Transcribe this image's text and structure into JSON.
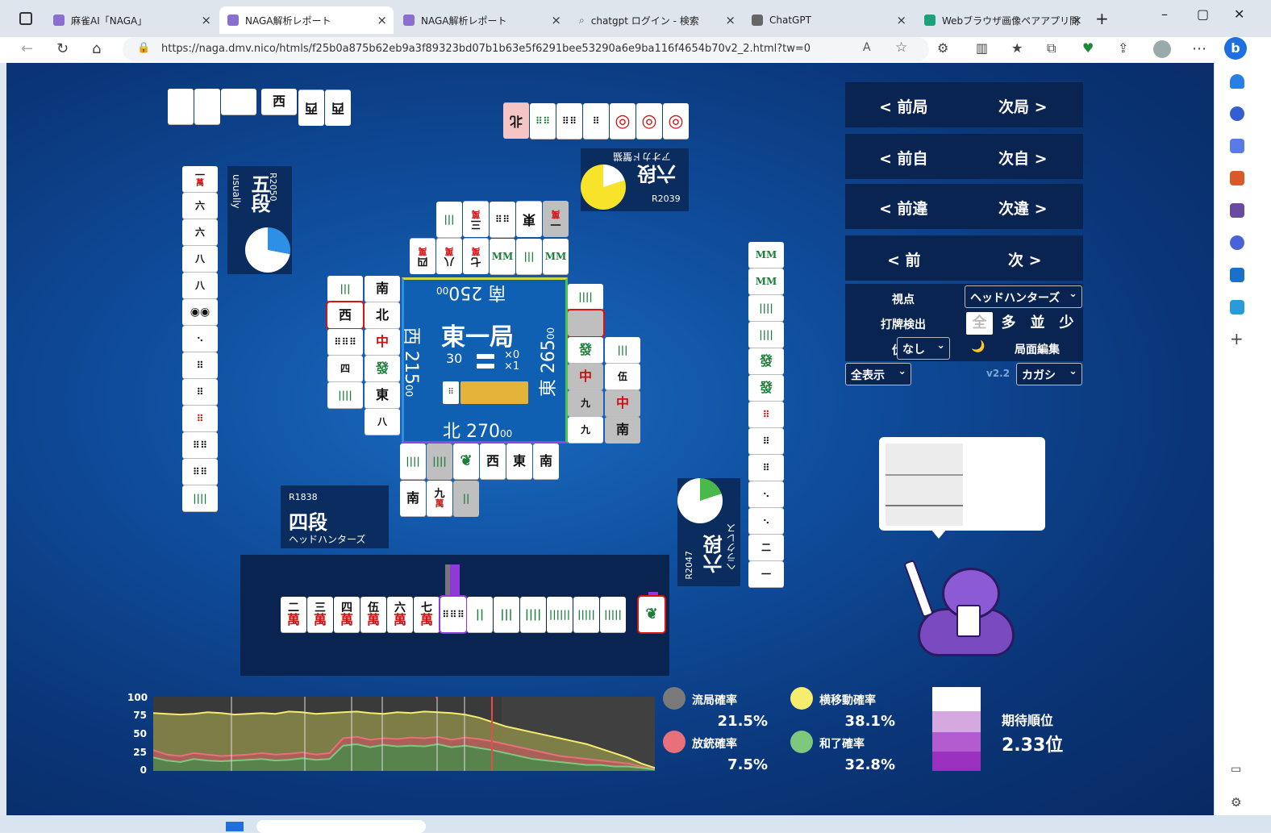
{
  "browser": {
    "tabs": [
      {
        "title": "麻雀AI「NAGA」",
        "active": false
      },
      {
        "title": "NAGA解析レポート",
        "active": true
      },
      {
        "title": "NAGA解析レポート",
        "active": false
      },
      {
        "title": "chatgpt ログイン - 検索",
        "active": false
      },
      {
        "title": "ChatGPT",
        "active": false
      },
      {
        "title": "Webブラウザ画像ペアアプリ開発",
        "active": false
      }
    ],
    "url": "https://naga.dmv.nico/htmls/f25b0a875b62eb9a3f89323bd07b1b63e5f6291bee53290a6e9ba116f4654b70v2_2.html?tw=0"
  },
  "board": {
    "round": "東一局",
    "honba_left": "30",
    "honba_x0": "×0",
    "honba_x1": "×1",
    "scores": {
      "south": "南 250",
      "south_sub": "00",
      "west": "西 215",
      "west_sub": "00",
      "east": "東 265",
      "east_sub": "00",
      "north": "北 270",
      "north_sub": "00"
    }
  },
  "players": {
    "top": {
      "rate": "R2039",
      "rank": "六段",
      "name": "アオカド蟹猫"
    },
    "left": {
      "rate": "R2050",
      "rank": "五段",
      "name": "usually"
    },
    "right": {
      "rate": "R2047",
      "rank": "六段",
      "name": "ヘラクレス"
    },
    "bottom": {
      "rate": "R1838",
      "rank": "四段",
      "name": "ヘッドハンターズ"
    }
  },
  "hand": [
    {
      "num": "二",
      "suit": "萬"
    },
    {
      "num": "三",
      "suit": "萬"
    },
    {
      "num": "四",
      "suit": "萬"
    },
    {
      "num": "伍",
      "suit": "萬"
    },
    {
      "num": "六",
      "suit": "萬"
    },
    {
      "num": "七",
      "suit": "萬"
    }
  ],
  "controls": {
    "prev_round": "< 前局",
    "next_round": "次局 >",
    "prev_self": "< 前自",
    "next_self": "次自 >",
    "prev_diff": "< 前違",
    "next_diff": "次違 >",
    "prev": "< 前",
    "next": "次 >",
    "viewpoint_label": "視点",
    "viewpoint_value": "ヘッドハンターズ",
    "detect_label": "打牌検出",
    "detect_options": [
      "全",
      "多",
      "並",
      "少"
    ],
    "hidden_label": "伏牌",
    "hidden_value": "なし",
    "moon_icon": "🌙",
    "edit_label": "局面編集",
    "display_value": "全表示",
    "version": "v2.2",
    "model_value": "カガシ"
  },
  "stats": {
    "draw_label": "流局確率",
    "draw_value": "21.5%",
    "move_label": "横移動確率",
    "move_value": "38.1%",
    "deal_in_label": "放銃確率",
    "deal_in_value": "7.5%",
    "win_label": "和了確率",
    "win_value": "32.8%",
    "rank_label": "期待順位",
    "rank_value": "2.33位",
    "colors": {
      "draw": "#7a7a7a",
      "move": "#f6ec6e",
      "deal_in": "#e8707a",
      "win": "#7ec87e"
    }
  },
  "chart_data": {
    "type": "area",
    "yticks": [
      "100",
      "75",
      "50",
      "25",
      "0"
    ],
    "ylim": [
      0,
      100
    ],
    "series": [
      {
        "values": [
          78,
          77,
          76,
          77,
          79,
          78,
          76,
          77,
          78,
          77,
          80,
          79,
          77,
          78,
          79,
          80,
          78,
          77,
          79,
          78,
          80,
          79,
          78,
          76,
          72,
          66,
          60,
          56,
          52,
          48,
          44,
          40,
          36,
          30,
          24,
          18,
          10,
          4
        ]
      },
      {
        "values": [
          28,
          22,
          20,
          24,
          22,
          20,
          21,
          22,
          24,
          22,
          23,
          25,
          22,
          24,
          44,
          46,
          42,
          44,
          43,
          45,
          44,
          46,
          42,
          45,
          43,
          40,
          36,
          32,
          28,
          24,
          20,
          18,
          16,
          14,
          12,
          10,
          6,
          2
        ]
      },
      {
        "values": [
          18,
          14,
          12,
          16,
          14,
          13,
          14,
          15,
          16,
          14,
          15,
          17,
          15,
          16,
          34,
          36,
          32,
          35,
          33,
          34,
          33,
          36,
          32,
          34,
          31,
          28,
          24,
          20,
          16,
          14,
          12,
          10,
          8,
          8,
          6,
          6,
          4,
          2
        ]
      }
    ]
  }
}
